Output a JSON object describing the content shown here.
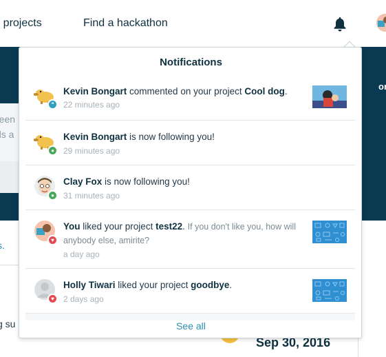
{
  "nav": {
    "explore_label": "Explore projects",
    "explore_visible": "re projects",
    "hackathon_label": "Find a hackathon",
    "bell_icon": "bell-icon"
  },
  "background": {
    "frag_tr": "reen",
    "frag_ds": "ds a",
    "frag_on": "on",
    "frag_s": "s.",
    "frag_gsu": "g su",
    "date": "Sep 30, 2016"
  },
  "notifications": {
    "title": "Notifications",
    "see_all": "See all",
    "items": [
      {
        "actor": "Kevin Bongart",
        "verb": "commented on your project",
        "object": "Cool dog",
        "suffix": ".",
        "time": "22 minutes ago",
        "badge": "comment",
        "has_thumb": true
      },
      {
        "actor": "Kevin Bongart",
        "verb": "is now following you!",
        "time": "29 minutes ago",
        "badge": "follow"
      },
      {
        "actor": "Clay Fox",
        "verb": "is now following you!",
        "time": "31 minutes ago",
        "badge": "follow"
      },
      {
        "actor": "You",
        "verb": "liked your project",
        "object": "test22",
        "suffix": ".",
        "message": "If you don't like you, how will anybody else, amirite?",
        "time": "a day ago",
        "badge": "like",
        "has_thumb": true
      },
      {
        "actor": "Holly Tiwari",
        "verb": "liked your project",
        "object": "goodbye",
        "suffix": ".",
        "time": "2 days ago",
        "badge": "like",
        "has_thumb": true
      }
    ]
  },
  "colors": {
    "navy": "#093a52",
    "link": "#2a8fb2",
    "badge_comment": "#2e9fc0",
    "badge_follow": "#48a85a",
    "badge_like": "#e24b52"
  }
}
